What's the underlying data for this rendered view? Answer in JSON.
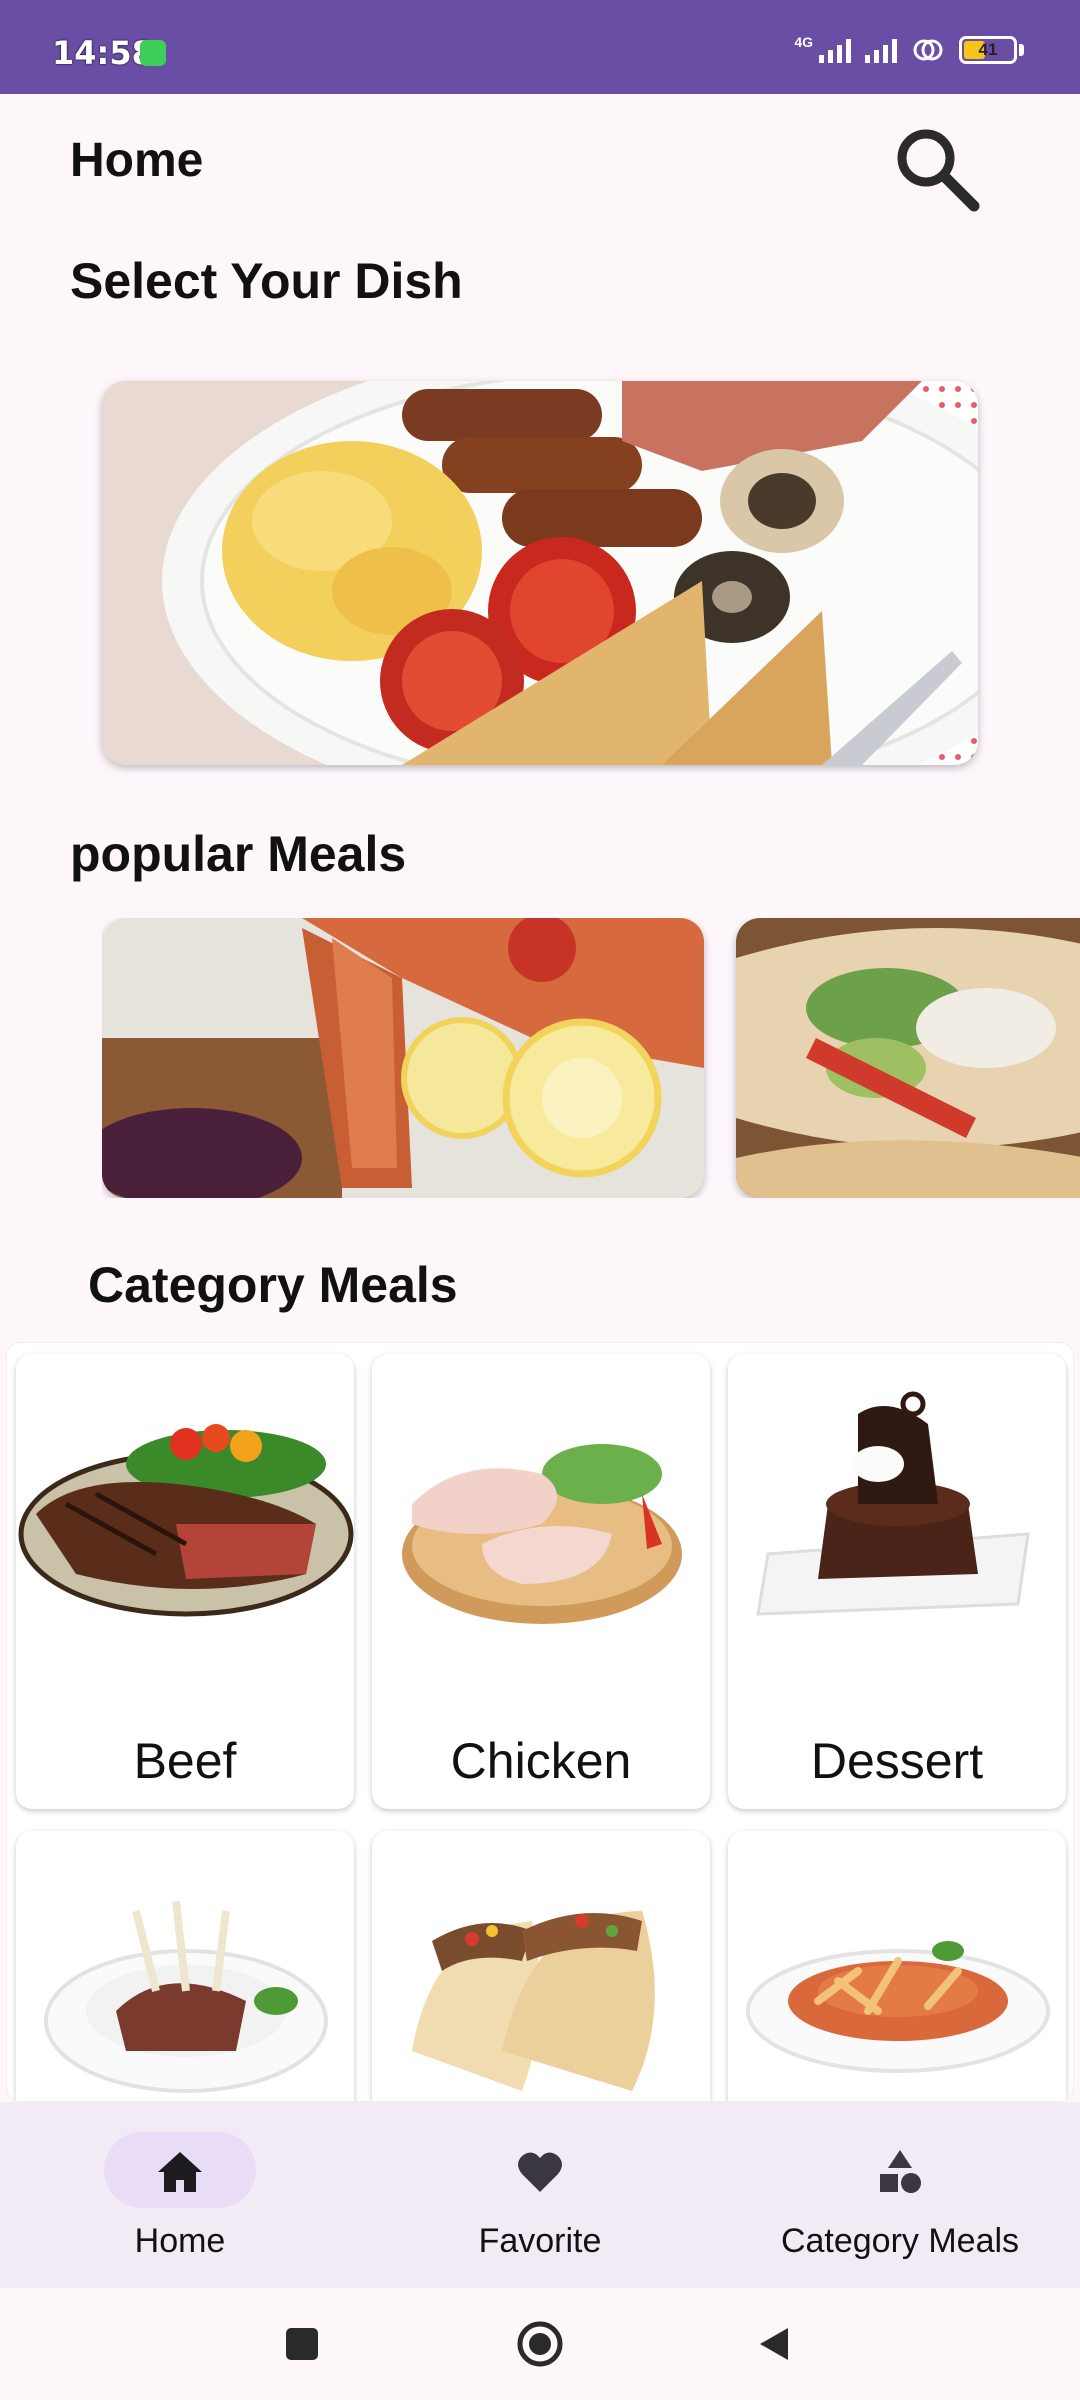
{
  "status_bar": {
    "time": "14:58",
    "network_label": "4G",
    "battery_level": "41",
    "battery_fraction": 0.41
  },
  "header": {
    "title": "Home",
    "search_icon": "search-icon"
  },
  "hero": {
    "title": "Select Your Dish",
    "image": "full-breakfast-plate"
  },
  "popular": {
    "title": "popular Meals",
    "items": [
      {
        "image": "grilled-salmon-with-lemon"
      },
      {
        "image": "chicken-tacos"
      }
    ]
  },
  "categories": {
    "title": "Category Meals",
    "items": [
      {
        "label": "Beef",
        "image": "beef-steak"
      },
      {
        "label": "Chicken",
        "image": "raw-chicken-legs"
      },
      {
        "label": "Dessert",
        "image": "chocolate-lava-cake"
      },
      {
        "label": "",
        "image": "lamb-rack"
      },
      {
        "label": "",
        "image": "tacos"
      },
      {
        "label": "",
        "image": "pasta-bowl"
      }
    ]
  },
  "bottom_nav": {
    "active": "Home",
    "items": [
      {
        "label": "Home",
        "icon": "home-icon"
      },
      {
        "label": "Favorite",
        "icon": "heart-icon"
      },
      {
        "label": "Category Meals",
        "icon": "shapes-icon"
      }
    ]
  },
  "system_nav": {
    "buttons": [
      "recents-icon",
      "home-circle-icon",
      "back-icon"
    ]
  },
  "colors": {
    "status_bar": "#6a4ea6",
    "background": "#fdf7fc",
    "nav_background": "#f2ebf5",
    "nav_active_pill": "#e8dcf6"
  }
}
